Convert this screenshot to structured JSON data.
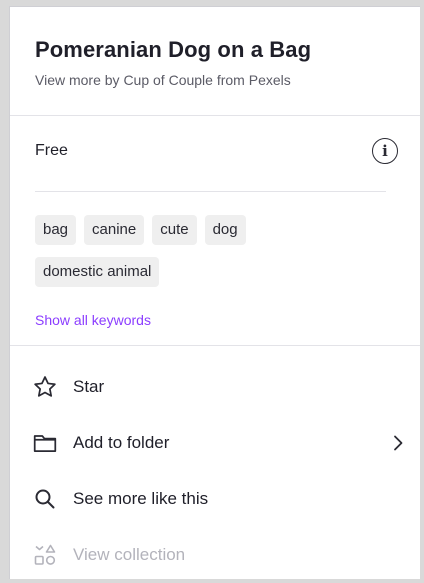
{
  "header": {
    "title": "Pomeranian Dog on a Bag",
    "subtitle": "View more by Cup of Couple from Pexels"
  },
  "license": {
    "label": "Free",
    "info_icon": "info-icon"
  },
  "tags": {
    "row1": [
      "bag",
      "canine",
      "cute",
      "dog"
    ],
    "row2": [
      "domestic animal"
    ],
    "show_all_label": "Show all keywords",
    "link_color": "#8b3dff"
  },
  "menu": {
    "items": [
      {
        "label": "Star",
        "icon": "star-icon"
      },
      {
        "label": "Add to folder",
        "icon": "folder-icon",
        "has_submenu": true
      },
      {
        "label": "See more like this",
        "icon": "search-icon"
      },
      {
        "label": "View collection",
        "icon": "collection-icon",
        "disabled": true
      }
    ]
  }
}
